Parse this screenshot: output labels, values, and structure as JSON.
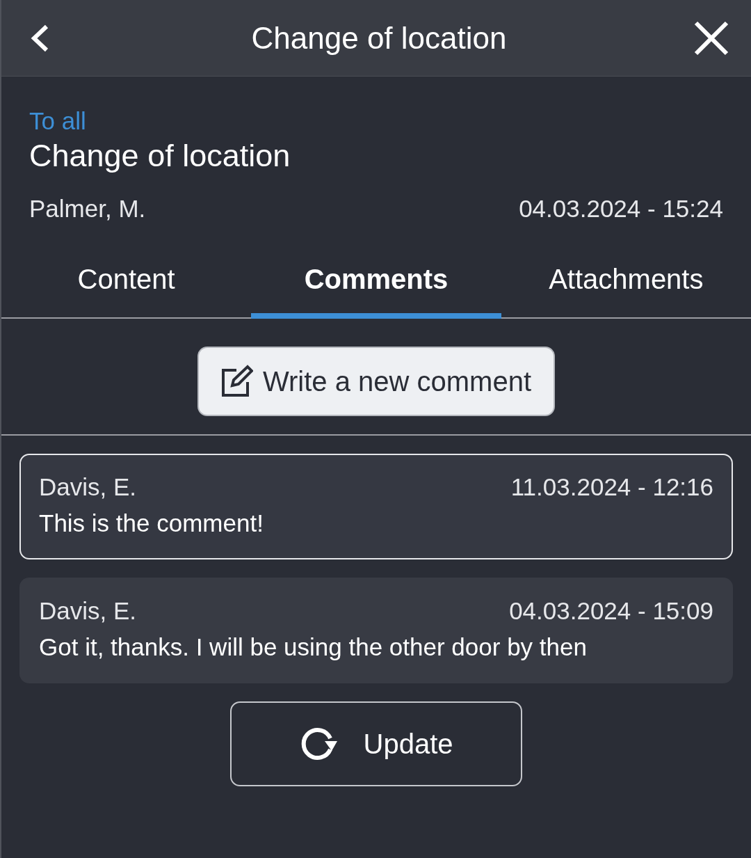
{
  "header": {
    "title": "Change of location"
  },
  "message": {
    "audience": "To all",
    "title": "Change of location",
    "author": "Palmer, M.",
    "date": "04.03.2024 - 15:24"
  },
  "tabs": [
    {
      "label": "Content",
      "selected": false
    },
    {
      "label": "Comments",
      "selected": true
    },
    {
      "label": "Attachments",
      "selected": false
    }
  ],
  "new_comment_button": "Write a new comment",
  "comments": [
    {
      "author": "Davis, E.",
      "date": "11.03.2024 - 12:16",
      "text": "This is the comment!",
      "selected": true
    },
    {
      "author": "Davis, E.",
      "date": "04.03.2024 - 15:09",
      "text": "Got it, thanks. I will be using the other door by then",
      "selected": false
    }
  ],
  "update_button": "Update"
}
